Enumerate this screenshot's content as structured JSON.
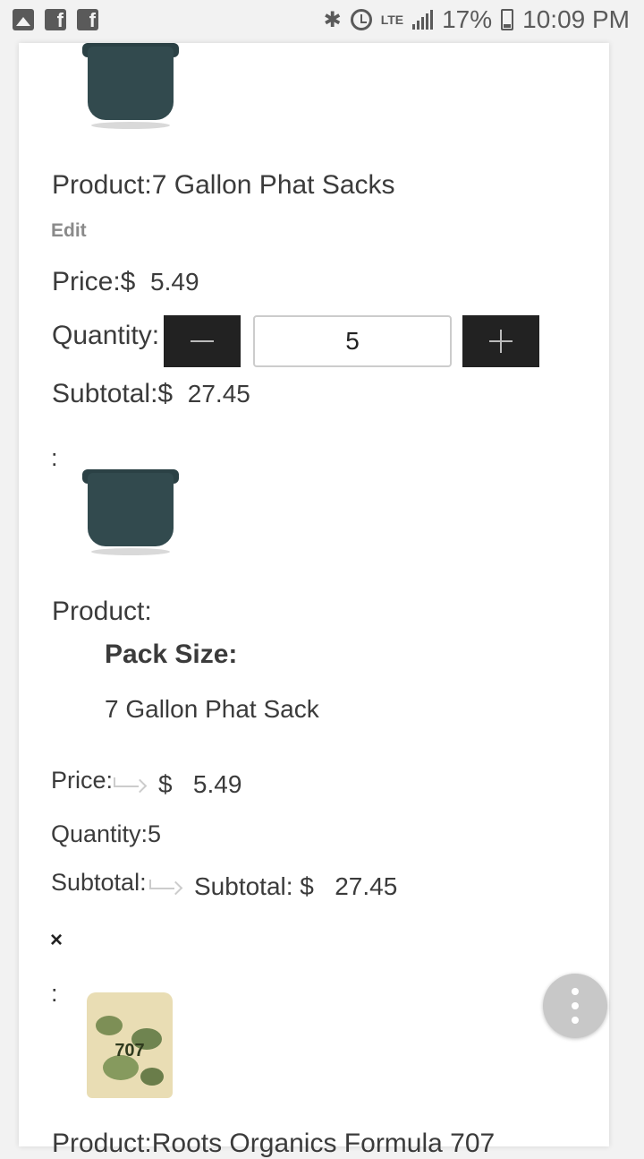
{
  "status_bar": {
    "battery": "17%",
    "time": "10:09 PM",
    "network": "LTE"
  },
  "item1": {
    "product_label": "Product:",
    "product_name": "7 Gallon Phat Sacks",
    "edit_label": "Edit",
    "price_label": "Price:$",
    "price_value": "5.49",
    "quantity_label": "Quantity:",
    "quantity_value": "5",
    "subtotal_label": "Subtotal:$",
    "subtotal_value": "27.45"
  },
  "item2": {
    "colon": ":",
    "product_label": "Product:",
    "pack_size_label": "Pack Size:",
    "pack_size_value": "7 Gallon Phat Sack",
    "price_label": "Price:",
    "price_currency": "$",
    "price_value": "5.49",
    "quantity_text": "Quantity:5",
    "subtotal_label": "Subtotal:",
    "subtotal_inner_label": "Subtotal: $",
    "subtotal_value": "27.45",
    "remove_label": "×"
  },
  "item3": {
    "colon": ":",
    "bag_label": "707",
    "product_text": "Product:Roots Organics Formula 707"
  }
}
